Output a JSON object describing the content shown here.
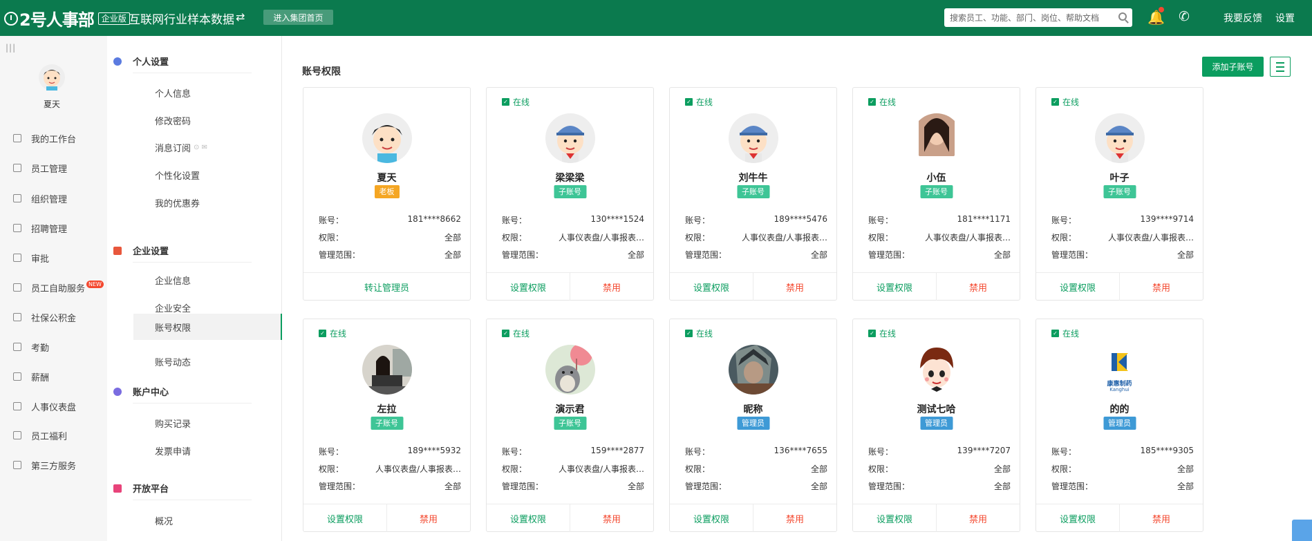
{
  "header": {
    "logo": "2号人事部",
    "edition": "企业版",
    "company": "互联网行业样本数据",
    "group_btn": "进入集团首页",
    "search_placeholder": "搜索员工、功能、部门、岗位、帮助文档",
    "feedback": "我要反馈",
    "settings": "设置"
  },
  "user": {
    "name": "夏天"
  },
  "leftnav": [
    {
      "label": "我的工作台",
      "icon": "monitor-icon"
    },
    {
      "label": "员工管理",
      "icon": "person-icon"
    },
    {
      "label": "组织管理",
      "icon": "org-icon"
    },
    {
      "label": "招聘管理",
      "icon": "recruit-icon"
    },
    {
      "label": "审批",
      "icon": "stamp-icon"
    },
    {
      "label": "员工自助服务",
      "icon": "mobile-icon",
      "badge": "NEW"
    },
    {
      "label": "社保公积金",
      "icon": "house-icon"
    },
    {
      "label": "考勤",
      "icon": "calendar-icon"
    },
    {
      "label": "薪酬",
      "icon": "money-icon"
    },
    {
      "label": "人事仪表盘",
      "icon": "dashboard-icon"
    },
    {
      "label": "员工福利",
      "icon": "gift-icon"
    },
    {
      "label": "第三方服务",
      "icon": "plugin-icon"
    }
  ],
  "subnav": {
    "personal": {
      "title": "个人设置",
      "items": [
        "个人信息",
        "修改密码",
        "消息订阅",
        "个性化设置",
        "我的优惠券"
      ]
    },
    "enterprise": {
      "title": "企业设置",
      "items": [
        "企业信息",
        "企业安全",
        "账号权限",
        "账号动态"
      ]
    },
    "account": {
      "title": "账户中心",
      "items": [
        "购买记录",
        "发票申请"
      ]
    },
    "open": {
      "title": "开放平台",
      "items": [
        "概况"
      ]
    }
  },
  "main": {
    "title": "账号权限",
    "add_btn": "添加子账号",
    "labels": {
      "account": "账号：",
      "perm": "权限：",
      "scope": "管理范围："
    },
    "online_label": "在线"
  },
  "colors": {
    "primary": "#0b7a4e",
    "accent": "#0b9d5f",
    "danger": "#f4482f",
    "boss": "#f5a623",
    "sub": "#3ec596",
    "admin": "#3e9ad6"
  },
  "cards": [
    {
      "name": "夏天",
      "role": "老板",
      "role_type": "boss",
      "online": false,
      "account": "181****8662",
      "perm": "全部",
      "scope": "全部",
      "actions": [
        "转让管理员"
      ],
      "avatar": "cartoon-boy"
    },
    {
      "name": "梁梁梁",
      "role": "子账号",
      "role_type": "sub",
      "online": true,
      "account": "130****1524",
      "perm": "人事仪表盘/人事报表…",
      "scope": "全部",
      "actions": [
        "设置权限",
        "禁用"
      ],
      "avatar": "cartoon-cap"
    },
    {
      "name": "刘牛牛",
      "role": "子账号",
      "role_type": "sub",
      "online": true,
      "account": "189****5476",
      "perm": "人事仪表盘/人事报表…",
      "scope": "全部",
      "actions": [
        "设置权限",
        "禁用"
      ],
      "avatar": "cartoon-cap"
    },
    {
      "name": "小伍",
      "role": "子账号",
      "role_type": "sub",
      "online": true,
      "account": "181****1171",
      "perm": "人事仪表盘/人事报表…",
      "scope": "全部",
      "actions": [
        "设置权限",
        "禁用"
      ],
      "avatar": "photo-woman"
    },
    {
      "name": "叶子",
      "role": "子账号",
      "role_type": "sub",
      "online": true,
      "account": "139****9714",
      "perm": "人事仪表盘/人事报表…",
      "scope": "全部",
      "actions": [
        "设置权限",
        "禁用"
      ],
      "avatar": "cartoon-cap"
    },
    {
      "name": "左拉",
      "role": "子账号",
      "role_type": "sub",
      "online": true,
      "account": "189****5932",
      "perm": "人事仪表盘/人事报表…",
      "scope": "全部",
      "actions": [
        "设置权限",
        "禁用"
      ],
      "avatar": "photo-laptop"
    },
    {
      "name": "演示君",
      "role": "子账号",
      "role_type": "sub",
      "online": true,
      "account": "159****2877",
      "perm": "人事仪表盘/人事报表…",
      "scope": "全部",
      "actions": [
        "设置权限",
        "禁用"
      ],
      "avatar": "totoro"
    },
    {
      "name": "昵称",
      "role": "管理员",
      "role_type": "admin",
      "online": true,
      "account": "136****7655",
      "perm": "全部",
      "scope": "全部",
      "actions": [
        "设置权限",
        "禁用"
      ],
      "avatar": "photo-warrior"
    },
    {
      "name": "测试七哈",
      "role": "管理员",
      "role_type": "admin",
      "online": true,
      "account": "139****7207",
      "perm": "全部",
      "scope": "全部",
      "actions": [
        "设置权限",
        "禁用"
      ],
      "avatar": "cartoon-kid"
    },
    {
      "name": "的的",
      "role": "管理员",
      "role_type": "admin",
      "online": true,
      "account": "185****9305",
      "perm": "全部",
      "scope": "全部",
      "actions": [
        "设置权限",
        "禁用"
      ],
      "avatar": "logo-brand",
      "logo_text": "康惠制药",
      "logo_sub": "Kanghui"
    }
  ]
}
